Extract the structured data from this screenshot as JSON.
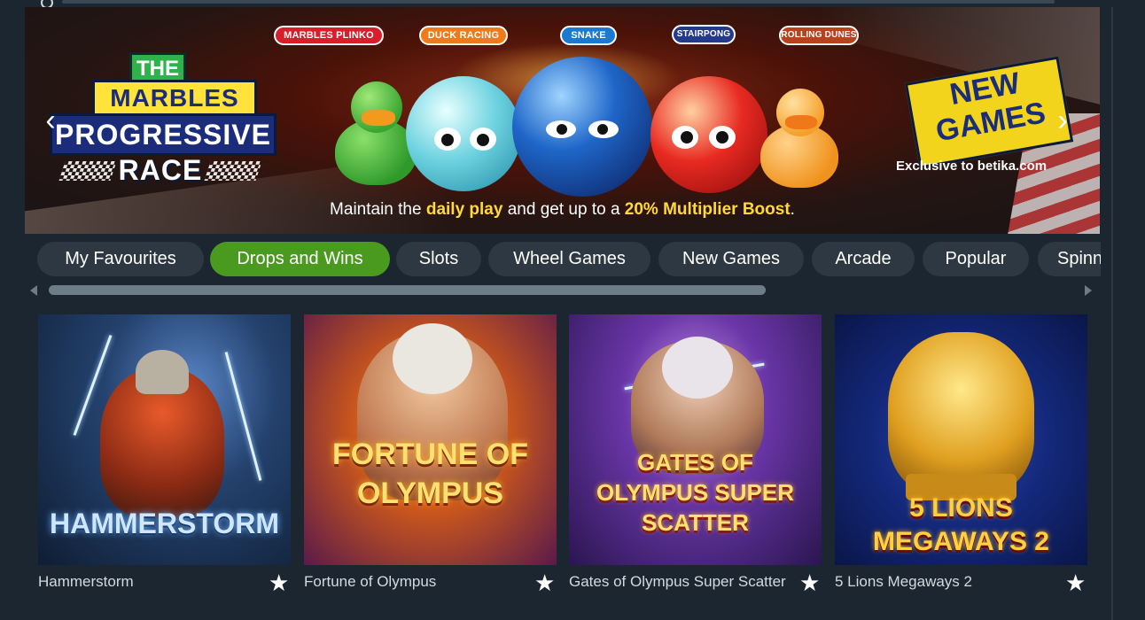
{
  "banner": {
    "game_pills": [
      "MARBLES PLINKO",
      "DUCK RACING",
      "SNAKE",
      "STAIRPONG",
      "ROLLING DUNES"
    ],
    "logo": {
      "line1": "THE",
      "line2": "MARBLES",
      "line3": "PROGRESSIVE",
      "line4": "RACE"
    },
    "new_games": {
      "line1": "NEW",
      "line2": "GAMES"
    },
    "exclusive": "Exclusive to betika.com",
    "tagline": {
      "pre": "Maintain the ",
      "hl1": "daily play",
      "mid": " and get up to a ",
      "hl2": "20% Multiplier Boost",
      "post": "."
    },
    "prev_arrow": "‹",
    "next_arrow": "›"
  },
  "categories": [
    {
      "label": "My Favourites",
      "active": false
    },
    {
      "label": "Drops and Wins",
      "active": true
    },
    {
      "label": "Slots",
      "active": false
    },
    {
      "label": "Wheel Games",
      "active": false
    },
    {
      "label": "New Games",
      "active": false
    },
    {
      "label": "Arcade",
      "active": false
    },
    {
      "label": "Popular",
      "active": false
    },
    {
      "label": "Spinners",
      "active": false
    }
  ],
  "games": [
    {
      "title": "Hammerstorm",
      "logo": "HAMMERSTORM",
      "favorite_icon": "star-icon"
    },
    {
      "title": "Fortune of Olympus",
      "logo": "FORTUNE OF OLYMPUS",
      "favorite_icon": "star-icon"
    },
    {
      "title": "Gates of Olympus Super Scatter",
      "logo": "GATES OF OLYMPUS SUPER SCATTER",
      "favorite_icon": "star-icon"
    },
    {
      "title": "5 Lions Megaways 2",
      "logo": "5 LIONS MEGAWAYS 2",
      "favorite_icon": "star-icon"
    }
  ],
  "colors": {
    "background": "#1c2630",
    "tab_bg": "#2d3843",
    "tab_active": "#4a9a1f",
    "highlight_yellow": "#ffd93a"
  }
}
